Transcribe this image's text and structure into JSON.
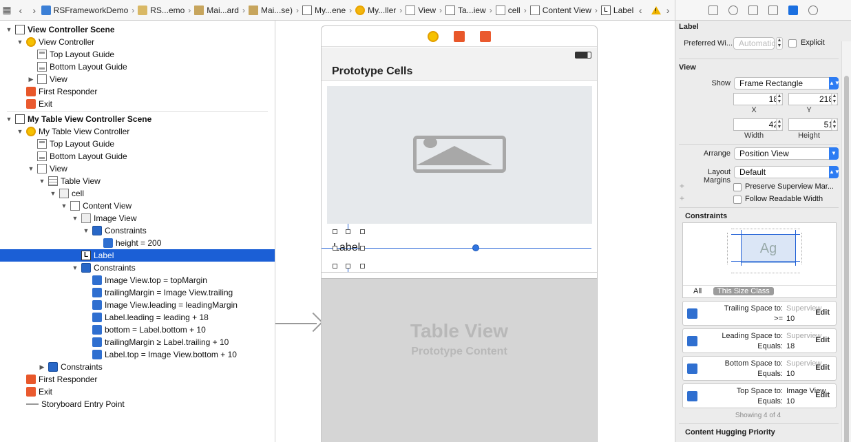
{
  "breadcrumbs": [
    "RSFrameworkDemo",
    "RS...emo",
    "Mai...ard",
    "Mai...se)",
    "My...ene",
    "My...ller",
    "View",
    "Ta...iew",
    "cell",
    "Content View",
    "Label"
  ],
  "outline": [
    {
      "label": "View Controller Scene",
      "indent": 0,
      "tri": "down",
      "icon": "scene",
      "scene": true
    },
    {
      "label": "View Controller",
      "indent": 1,
      "tri": "down",
      "icon": "vc"
    },
    {
      "label": "Top Layout Guide",
      "indent": 2,
      "tri": "",
      "icon": "guide"
    },
    {
      "label": "Bottom Layout Guide",
      "indent": 2,
      "tri": "",
      "icon": "guide-bottom"
    },
    {
      "label": "View",
      "indent": 2,
      "tri": "right",
      "icon": "view"
    },
    {
      "label": "First Responder",
      "indent": 1,
      "tri": "",
      "icon": "responder"
    },
    {
      "label": "Exit",
      "indent": 1,
      "tri": "",
      "icon": "exit"
    },
    {
      "label": "My Table View Controller Scene",
      "indent": 0,
      "tri": "down",
      "icon": "scene",
      "scene": true
    },
    {
      "label": "My Table View Controller",
      "indent": 1,
      "tri": "down",
      "icon": "vc"
    },
    {
      "label": "Top Layout Guide",
      "indent": 2,
      "tri": "",
      "icon": "guide"
    },
    {
      "label": "Bottom Layout Guide",
      "indent": 2,
      "tri": "",
      "icon": "guide-bottom"
    },
    {
      "label": "View",
      "indent": 2,
      "tri": "down",
      "icon": "view"
    },
    {
      "label": "Table View",
      "indent": 3,
      "tri": "down",
      "icon": "table"
    },
    {
      "label": "cell",
      "indent": 4,
      "tri": "down",
      "icon": "cell"
    },
    {
      "label": "Content View",
      "indent": 5,
      "tri": "down",
      "icon": "view"
    },
    {
      "label": "Image View",
      "indent": 6,
      "tri": "down",
      "icon": "imageview"
    },
    {
      "label": "Constraints",
      "indent": 7,
      "tri": "down",
      "icon": "constraints"
    },
    {
      "label": "height = 200",
      "indent": 8,
      "tri": "",
      "icon": "constraint"
    },
    {
      "label": "Label",
      "indent": 6,
      "tri": "",
      "icon": "label",
      "selected": true
    },
    {
      "label": "Constraints",
      "indent": 6,
      "tri": "down",
      "icon": "constraints"
    },
    {
      "label": "Image View.top = topMargin",
      "indent": 7,
      "tri": "",
      "icon": "constraint"
    },
    {
      "label": "trailingMargin = Image View.trailing",
      "indent": 7,
      "tri": "",
      "icon": "constraint"
    },
    {
      "label": "Image View.leading = leadingMargin",
      "indent": 7,
      "tri": "",
      "icon": "constraint"
    },
    {
      "label": "Label.leading = leading + 18",
      "indent": 7,
      "tri": "",
      "icon": "constraint"
    },
    {
      "label": "bottom = Label.bottom + 10",
      "indent": 7,
      "tri": "",
      "icon": "constraint"
    },
    {
      "label": "trailingMargin ≥ Label.trailing + 10",
      "indent": 7,
      "tri": "",
      "icon": "constraint"
    },
    {
      "label": "Label.top = Image View.bottom + 10",
      "indent": 7,
      "tri": "",
      "icon": "constraint"
    },
    {
      "label": "Constraints",
      "indent": 3,
      "tri": "right",
      "icon": "constraints"
    },
    {
      "label": "First Responder",
      "indent": 1,
      "tri": "",
      "icon": "responder"
    },
    {
      "label": "Exit",
      "indent": 1,
      "tri": "",
      "icon": "exit"
    },
    {
      "label": "Storyboard Entry Point",
      "indent": 1,
      "tri": "",
      "icon": "entry"
    }
  ],
  "canvas": {
    "nav_title": "Prototype Cells",
    "cell_label": "Label",
    "table_title": "Table View",
    "table_subtitle": "Prototype Content"
  },
  "inspector": {
    "label_section": "Label",
    "preferred_width_label": "Preferred Wi...",
    "preferred_width_placeholder": "Automatic",
    "explicit_label": "Explicit",
    "view_section": "View",
    "show_label": "Show",
    "show_value": "Frame Rectangle",
    "x": "18",
    "y": "218",
    "x_caption": "X",
    "y_caption": "Y",
    "width": "42",
    "height": "51",
    "width_caption": "Width",
    "height_caption": "Height",
    "arrange_label": "Arrange",
    "arrange_value": "Position View",
    "layout_margins_label": "Layout Margins",
    "layout_margins_value": "Default",
    "preserve_label": "Preserve Superview Mar...",
    "follow_label": "Follow Readable Width",
    "constraints_section": "Constraints",
    "ag_text": "Ag",
    "tab_all": "All",
    "tab_size_class": "This Size Class",
    "constraint_cards": [
      {
        "l1": "Trailing Space to:",
        "v1": "Superview",
        "v1_dark": false,
        "l2": ">=",
        "v2": "10",
        "edit": "Edit"
      },
      {
        "l1": "Leading Space to:",
        "v1": "Superview",
        "v1_dark": false,
        "l2": "Equals:",
        "v2": "18",
        "edit": "Edit"
      },
      {
        "l1": "Bottom Space to:",
        "v1": "Superview",
        "v1_dark": false,
        "l2": "Equals:",
        "v2": "10",
        "edit": "Edit"
      },
      {
        "l1": "Top Space to:",
        "v1": "Image View",
        "v1_dark": true,
        "l2": "Equals:",
        "v2": "10",
        "edit": "Edit"
      }
    ],
    "showing": "Showing 4 of 4",
    "hugging_section": "Content Hugging Priority"
  }
}
